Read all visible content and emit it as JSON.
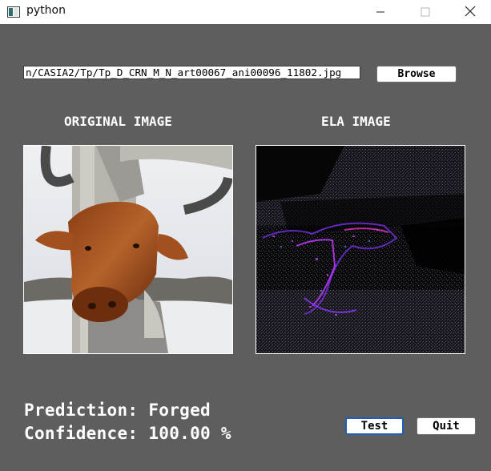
{
  "window": {
    "title": "python",
    "icons": {
      "app": "python-window-icon",
      "minimize": "minimize-icon",
      "maximize": "maximize-icon",
      "close": "close-icon"
    }
  },
  "file": {
    "path": "n/CASIA2/Tp/Tp_D_CRN_M_N_art00067_ani00096_11802.jpg",
    "browse_label": "Browse"
  },
  "panels": {
    "original_label": "ORIGINAL IMAGE",
    "ela_label": "ELA IMAGE"
  },
  "result": {
    "prediction": "Prediction: Forged",
    "confidence": "Confidence: 100.00 %"
  },
  "actions": {
    "test_label": "Test",
    "quit_label": "Quit"
  },
  "colors": {
    "window_bg": "#5e5e5e",
    "titlebar_bg": "#ffffff",
    "focus_border": "#1f5fb8",
    "text_light": "#ffffff"
  }
}
